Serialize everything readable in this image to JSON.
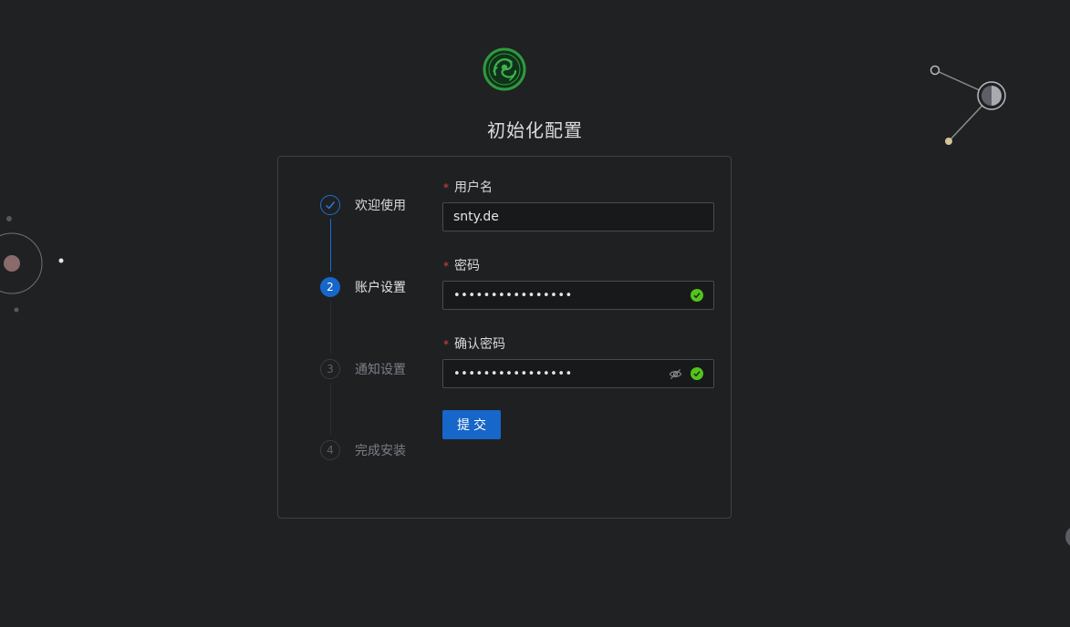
{
  "page": {
    "title": "初始化配置"
  },
  "steps": [
    {
      "number": "",
      "label": "欢迎使用",
      "status": "finished"
    },
    {
      "number": "2",
      "label": "账户设置",
      "status": "active"
    },
    {
      "number": "3",
      "label": "通知设置",
      "status": "waiting"
    },
    {
      "number": "4",
      "label": "完成安装",
      "status": "waiting"
    }
  ],
  "form": {
    "required_mark": "*",
    "username": {
      "label": "用户名",
      "value": "snty.de"
    },
    "password": {
      "label": "密码",
      "value": "••••••••••••••••",
      "validated": true
    },
    "confirm_password": {
      "label": "确认密码",
      "value": "••••••••••••••••",
      "validated": true
    },
    "submit_label": "提交"
  },
  "icons": {
    "logo": "dragon-logo-icon",
    "step_done": "check-icon",
    "validated": "check-circle-icon",
    "toggle_visibility": "eye-invisible-icon"
  },
  "colors": {
    "background": "#1f2123",
    "primary": "#1766c9",
    "success": "#52c41a",
    "required": "#e0433f",
    "logo": "#2e9a3e"
  }
}
